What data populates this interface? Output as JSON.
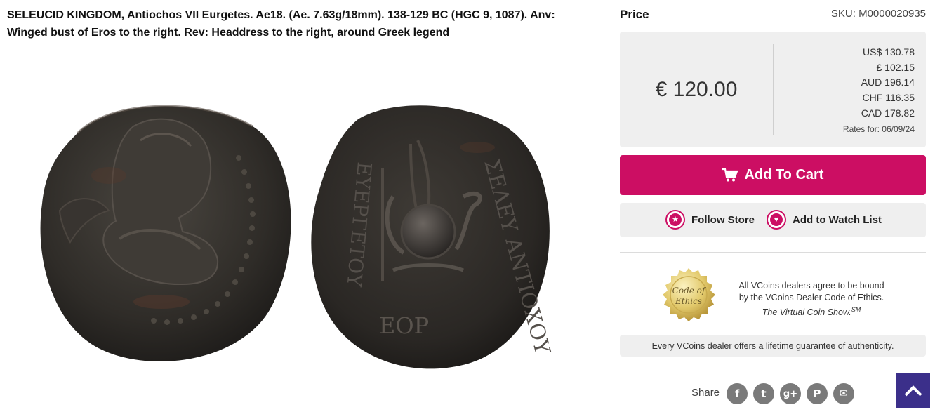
{
  "listing": {
    "title": "SELEUCID KINGDOM, Antiochos VII Eurgetes. Ae18. (Ae. 7.63g/18mm). 138-129 BC (HGC 9, 1087). Anv: Winged bust of Eros to the right. Rev: Headdress to the right, around Greek legend"
  },
  "coin_image": {
    "reverse_legend_right": "ΣΕΛΕΥ ΑΝΤΙΟΧΟΥ",
    "reverse_legend_left": "ΕΥΕΡΓΕΤΟΥ",
    "reverse_date": "ΕΟΡ"
  },
  "price_panel": {
    "heading": "Price",
    "sku": "SKU: M0000020935",
    "main_price": "€ 120.00",
    "conversions": [
      "US$ 130.78",
      "£ 102.15",
      "AUD 196.14",
      "CHF 116.35",
      "CAD 178.82"
    ],
    "rates_date": "Rates for: 06/09/24"
  },
  "actions": {
    "add_to_cart": "Add To Cart",
    "follow_store": "Follow Store",
    "add_to_watch_list": "Add to Watch List"
  },
  "ethics": {
    "seal_line1": "Code of",
    "seal_line2": "Ethics",
    "line1": "All VCoins dealers agree to be bound",
    "line2": "by the VCoins Dealer Code of Ethics.",
    "line3": "The Virtual Coin Show.",
    "line3_sup": "SM"
  },
  "guarantee_text": "Every VCoins dealer offers a lifetime guarantee of authenticity.",
  "share": {
    "label": "Share",
    "icons": [
      {
        "name": "facebook-icon",
        "glyph": "f"
      },
      {
        "name": "twitter-icon",
        "glyph": "t"
      },
      {
        "name": "google-plus-icon",
        "glyph": "g+"
      },
      {
        "name": "pinterest-icon",
        "glyph": "P"
      },
      {
        "name": "email-icon",
        "glyph": "✉"
      }
    ]
  },
  "colors": {
    "accent": "#cc0e63",
    "panel_bg": "#efefef",
    "back_to_top": "#3b2f8a"
  }
}
